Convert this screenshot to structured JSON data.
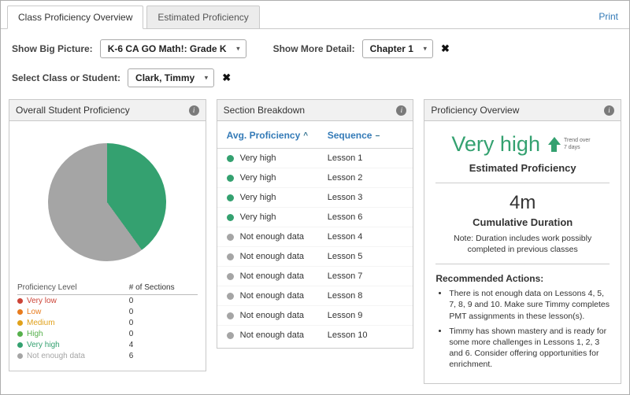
{
  "colors": {
    "green": "#34a170",
    "gray": "#a5a5a5",
    "blue": "#337ab7"
  },
  "icons": {
    "caret_down": "▾",
    "clear": "✖",
    "info": "i",
    "sort_up": "^",
    "sort_none": "−"
  },
  "header": {
    "tabs": [
      {
        "label": "Class Proficiency Overview"
      },
      {
        "label": "Estimated Proficiency"
      }
    ],
    "print_label": "Print"
  },
  "filters": {
    "big_picture": {
      "label": "Show Big Picture:",
      "value": "K-6 CA GO Math!: Grade K"
    },
    "more_detail": {
      "label": "Show More Detail:",
      "value": "Chapter 1"
    },
    "class_student": {
      "label": "Select Class or Student:",
      "value": "Clark, Timmy"
    }
  },
  "overall": {
    "title": "Overall Student Proficiency",
    "legend": {
      "col1": "Proficiency Level",
      "col2": "# of Sections",
      "rows": [
        {
          "label": "Very low",
          "count": "0",
          "color": "#cc4437"
        },
        {
          "label": "Low",
          "count": "0",
          "color": "#e87c1e"
        },
        {
          "label": "Medium",
          "count": "0",
          "color": "#e0a11b"
        },
        {
          "label": "High",
          "count": "0",
          "color": "#56b04c"
        },
        {
          "label": "Very high",
          "count": "4",
          "color": "#34a170"
        },
        {
          "label": "Not enough data",
          "count": "6",
          "color": "#a5a5a5"
        }
      ]
    }
  },
  "breakdown": {
    "title": "Section Breakdown",
    "col1": "Avg. Proficiency",
    "col2": "Sequence",
    "rows": [
      {
        "proficiency": "Very high",
        "lesson": "Lesson 1",
        "color": "#34a170"
      },
      {
        "proficiency": "Very high",
        "lesson": "Lesson 2",
        "color": "#34a170"
      },
      {
        "proficiency": "Very high",
        "lesson": "Lesson 3",
        "color": "#34a170"
      },
      {
        "proficiency": "Very high",
        "lesson": "Lesson 6",
        "color": "#34a170"
      },
      {
        "proficiency": "Not enough data",
        "lesson": "Lesson 4",
        "color": "#a5a5a5"
      },
      {
        "proficiency": "Not enough data",
        "lesson": "Lesson 5",
        "color": "#a5a5a5"
      },
      {
        "proficiency": "Not enough data",
        "lesson": "Lesson 7",
        "color": "#a5a5a5"
      },
      {
        "proficiency": "Not enough data",
        "lesson": "Lesson 8",
        "color": "#a5a5a5"
      },
      {
        "proficiency": "Not enough data",
        "lesson": "Lesson 9",
        "color": "#a5a5a5"
      },
      {
        "proficiency": "Not enough data",
        "lesson": "Lesson 10",
        "color": "#a5a5a5"
      }
    ]
  },
  "overview": {
    "title": "Proficiency Overview",
    "level": "Very high",
    "trend_label": "Trend over 7 days",
    "estimated_label": "Estimated Proficiency",
    "duration": "4m",
    "duration_label": "Cumulative Duration",
    "note": "Note: Duration includes work possibly completed in previous classes",
    "actions_title": "Recommended Actions:",
    "actions": [
      "There is not enough data on Lessons 4, 5, 7, 8, 9 and 10. Make sure Timmy completes PMT assignments in these lesson(s).",
      "Timmy has shown mastery and is ready for some more challenges in Lessons 1, 2, 3 and 6. Consider offering opportunities for enrichment."
    ]
  },
  "chart_data": {
    "type": "pie",
    "title": "Overall Student Proficiency",
    "categories": [
      "Very low",
      "Low",
      "Medium",
      "High",
      "Very high",
      "Not enough data"
    ],
    "values": [
      0,
      0,
      0,
      0,
      4,
      6
    ],
    "colors": [
      "#cc4437",
      "#e87c1e",
      "#e0a11b",
      "#56b04c",
      "#34a170",
      "#a5a5a5"
    ],
    "legend_position": "bottom"
  }
}
